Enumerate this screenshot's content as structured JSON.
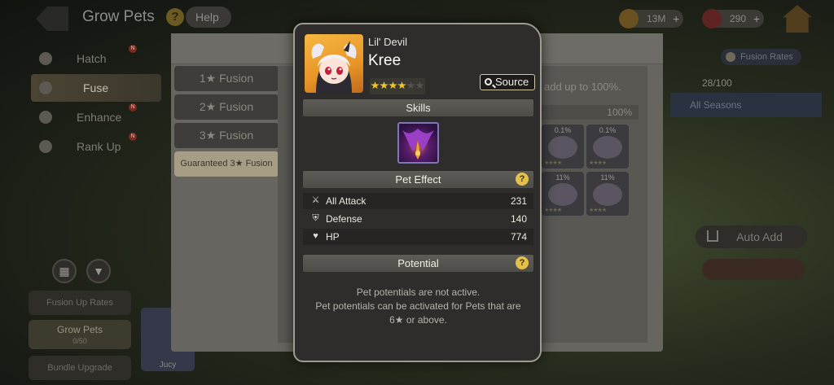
{
  "background": {
    "top_title": "Grow Pets",
    "help_label": "Help",
    "currency_1": "13M",
    "currency_2": "290",
    "left_menu": [
      "Hatch",
      "Fuse",
      "Enhance",
      "Rank Up"
    ],
    "fusion_tabs": [
      "1★ Fusion",
      "2★ Fusion",
      "3★ Fusion",
      "Guaranteed 3★ Fusion"
    ],
    "panel_text": "add up to 100%.",
    "percent_label": "100%",
    "card_percents": [
      "0.1%",
      "0.1%",
      "11%",
      "11%"
    ],
    "fusion_rates_label": "Fusion Rates",
    "right_label_1": "28/100",
    "right_label_2": "All Seasons",
    "auto_add_label": "Auto Add",
    "side_buttons": [
      "Fusion Up Rates",
      "Grow Pets",
      "Bundle Upgrade"
    ],
    "grow_pets_sub": "0/50",
    "pet_thumb_name": "Jucy"
  },
  "modal": {
    "species": "Lil' Devil",
    "name": "Kree",
    "stars_total": 6,
    "stars_filled": 4,
    "source_label": "Source",
    "skills_header": "Skills",
    "pet_effect_header": "Pet Effect",
    "stats": [
      {
        "label": "All Attack",
        "value": "231",
        "icon": "sword-icon"
      },
      {
        "label": "Defense",
        "value": "140",
        "icon": "shield-icon"
      },
      {
        "label": "HP",
        "value": "774",
        "icon": "heart-icon"
      }
    ],
    "potential_header": "Potential",
    "potential_line_1": "Pet potentials are not active.",
    "potential_line_2": "Pet potentials can be activated for Pets that are 6★ or above."
  },
  "colors": {
    "star_on": "#f2c72d",
    "help_badge": "#e4c24a",
    "modal_bg": "#2e2d2b",
    "section_bar": "#5e5c56"
  }
}
